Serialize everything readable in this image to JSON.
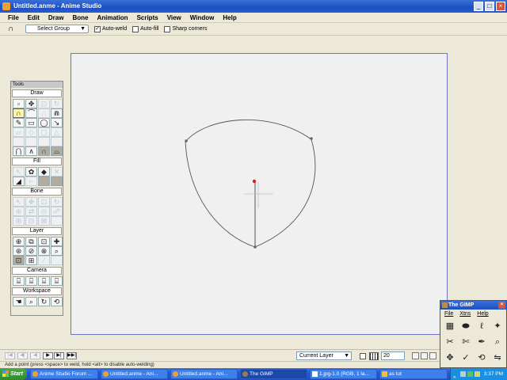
{
  "window": {
    "title": "Untitled.anme - Anime Studio",
    "buttons": [
      "_",
      "□",
      "×"
    ]
  },
  "menubar": [
    "File",
    "Edit",
    "Draw",
    "Bone",
    "Animation",
    "Scripts",
    "View",
    "Window",
    "Help"
  ],
  "options": {
    "select_group": "Select Group",
    "auto_weld": "Auto-weld",
    "auto_weld_checked": true,
    "auto_fill": "Auto-fill",
    "auto_fill_checked": false,
    "sharp_corners": "Sharp corners",
    "sharp_corners_checked": false
  },
  "tools_panel": {
    "title": "Tools",
    "sections": {
      "draw": "Draw",
      "fill": "Fill",
      "bone": "Bone",
      "layer": "Layer",
      "camera": "Camera",
      "workspace": "Workspace"
    }
  },
  "timeline": {
    "current_layer": "Current Layer",
    "frame_value": "20"
  },
  "status": {
    "text": "Add a point (press <space> to weld, hold <alt> to disable auto-welding)"
  },
  "gimp": {
    "title": "The GIMP",
    "menu": [
      "File",
      "Xtns",
      "Help"
    ]
  },
  "taskbar": {
    "start": "Start",
    "tasks": [
      "Anime Studio Forum ...",
      "Untitled.anme - Ani...",
      "Untitled.anme - Ani...",
      "The GIMP",
      "1.jpg-1.0 (RGB, 1 la...",
      "as tut"
    ],
    "clock": "3:37 PM"
  }
}
